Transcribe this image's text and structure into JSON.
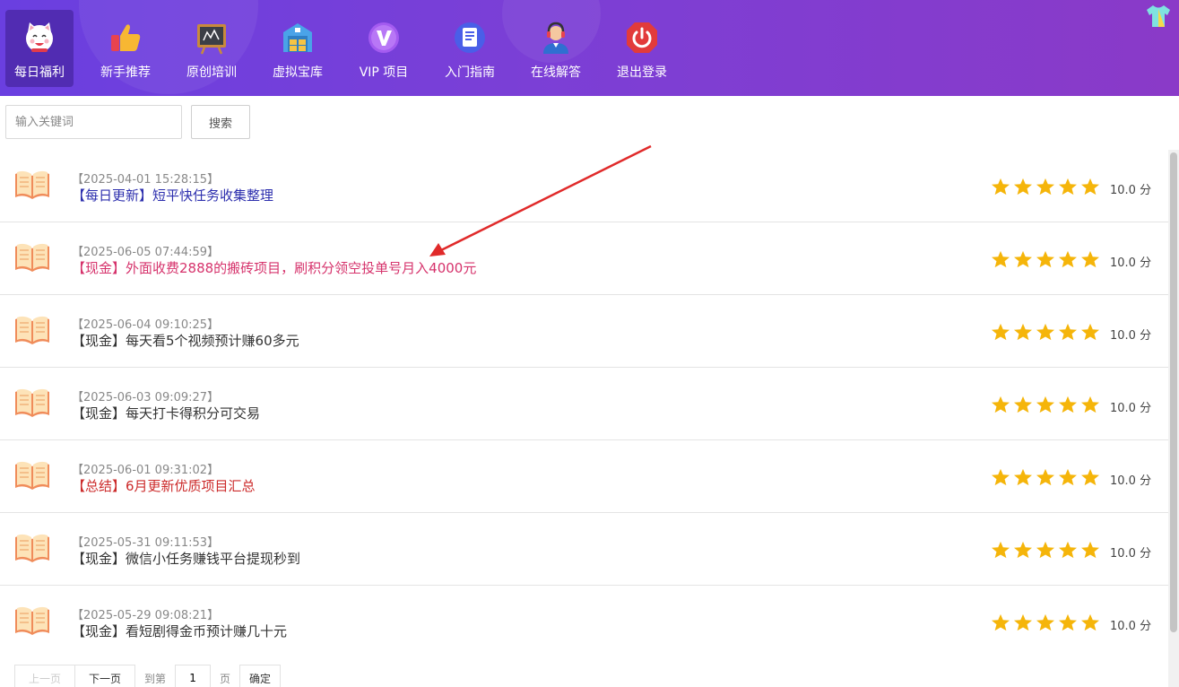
{
  "nav": {
    "items": [
      {
        "label": "每日福利",
        "icon": "lucky-cat-icon",
        "active": true
      },
      {
        "label": "新手推荐",
        "icon": "thumbs-up-icon",
        "active": false
      },
      {
        "label": "原创培训",
        "icon": "blackboard-icon",
        "active": false
      },
      {
        "label": "虚拟宝库",
        "icon": "storehouse-icon",
        "active": false
      },
      {
        "label": "VIP 项目",
        "icon": "vip-badge-icon",
        "active": false
      },
      {
        "label": "入门指南",
        "icon": "document-icon",
        "active": false
      },
      {
        "label": "在线解答",
        "icon": "support-agent-icon",
        "active": false
      },
      {
        "label": "退出登录",
        "icon": "power-off-icon",
        "active": false
      }
    ],
    "skin_icon": "tshirt-icon"
  },
  "search": {
    "placeholder": "输入关键词",
    "button_label": "搜索"
  },
  "list": [
    {
      "date": "【2025-04-01 15:28:15】",
      "title": "【每日更新】短平快任务收集整理",
      "title_color": "#2d2fae",
      "stars": 5,
      "score": "10.0 分"
    },
    {
      "date": "【2025-06-05 07:44:59】",
      "title": "【现金】外面收费2888的搬砖项目，刷积分领空投单号月入4000元",
      "title_color": "#d6336c",
      "stars": 5,
      "score": "10.0 分"
    },
    {
      "date": "【2025-06-04 09:10:25】",
      "title": "【现金】每天看5个视频预计赚60多元",
      "title_color": "#333333",
      "stars": 5,
      "score": "10.0 分"
    },
    {
      "date": "【2025-06-03 09:09:27】",
      "title": "【现金】每天打卡得积分可交易",
      "title_color": "#333333",
      "stars": 5,
      "score": "10.0 分"
    },
    {
      "date": "【2025-06-01 09:31:02】",
      "title": "【总结】6月更新优质项目汇总",
      "title_color": "#cc2b2b",
      "stars": 5,
      "score": "10.0 分"
    },
    {
      "date": "【2025-05-31 09:11:53】",
      "title": "【现金】微信小任务赚钱平台提现秒到",
      "title_color": "#333333",
      "stars": 5,
      "score": "10.0 分"
    },
    {
      "date": "【2025-05-29 09:08:21】",
      "title": "【现金】看短剧得金币预计赚几十元",
      "title_color": "#333333",
      "stars": 5,
      "score": "10.0 分"
    }
  ],
  "pager": {
    "prev_label": "上一页",
    "next_label": "下一页",
    "goto_label": "到第",
    "page_value": "1",
    "page_unit": "页",
    "confirm_label": "确定"
  },
  "colors": {
    "nav_start": "#6a3fe0",
    "nav_end": "#8a3ac8",
    "star": "#f5b50a",
    "annotation_arrow": "#e02a2a"
  }
}
